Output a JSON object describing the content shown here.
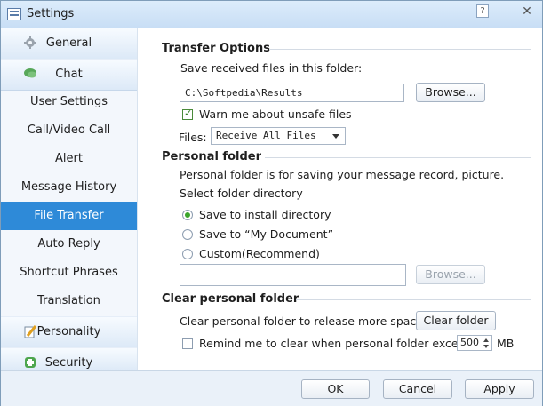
{
  "window": {
    "title": "Settings",
    "help_icon": "?",
    "minimize_icon": "–",
    "close_icon": "✕"
  },
  "sidebar": {
    "general": "General",
    "chat": "Chat",
    "items": [
      "User Settings",
      "Call/Video Call",
      "Alert",
      "Message History",
      "File Transfer",
      "Auto Reply",
      "Shortcut Phrases",
      "Translation"
    ],
    "selected": "File Transfer",
    "personality": "Personality",
    "security": "Security"
  },
  "transfer": {
    "heading": "Transfer Options",
    "save_label": "Save received files in this folder:",
    "path": "C:\\Softpedia\\Results",
    "browse": "Browse...",
    "warn_label": "Warn me about unsafe files",
    "warn_checked": true,
    "files_label": "Files:",
    "files_value": "Receive All Files"
  },
  "personal": {
    "heading": "Personal folder",
    "desc": "Personal folder is for saving your message record, picture.",
    "select_label": "Select folder directory",
    "options": [
      "Save to install directory",
      "Save to “My Document”",
      "Custom(Recommend)"
    ],
    "selected_option": 0,
    "custom_path": "",
    "browse": "Browse..."
  },
  "clear": {
    "heading": "Clear personal folder",
    "desc": "Clear personal folder to release more space",
    "button": "Clear folder",
    "remind_label": "Remind me to clear when personal folder exceed",
    "remind_checked": false,
    "limit": "500",
    "unit": "MB"
  },
  "footer": {
    "ok": "OK",
    "cancel": "Cancel",
    "apply": "Apply"
  }
}
